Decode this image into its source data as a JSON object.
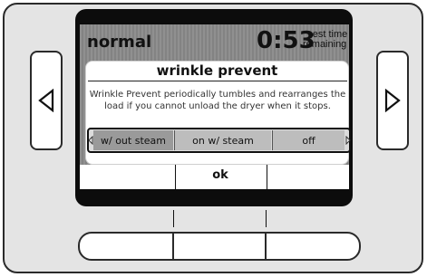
{
  "status": {
    "mode": "normal",
    "time": "0:53",
    "time_label_line1": "est time",
    "time_label_line2": "remaining"
  },
  "dialog": {
    "title": "wrinkle prevent",
    "description": "Wrinkle Prevent periodically tumbles and rearranges the load if you cannot unload the dryer when it stops."
  },
  "options": [
    {
      "label": "w/ out steam",
      "selected": true
    },
    {
      "label": "on w/ steam",
      "selected": false
    },
    {
      "label": "off",
      "selected": false
    }
  ],
  "softkeys": {
    "center_label": "ok"
  },
  "icons": {
    "left_button": "left-triangle-icon",
    "right_button": "right-triangle-icon"
  },
  "colors": {
    "panel": "#e4e4e4",
    "screen": "#8a8a8a",
    "frame": "#0c0c0c",
    "selected_option": "#9a9a9a"
  }
}
